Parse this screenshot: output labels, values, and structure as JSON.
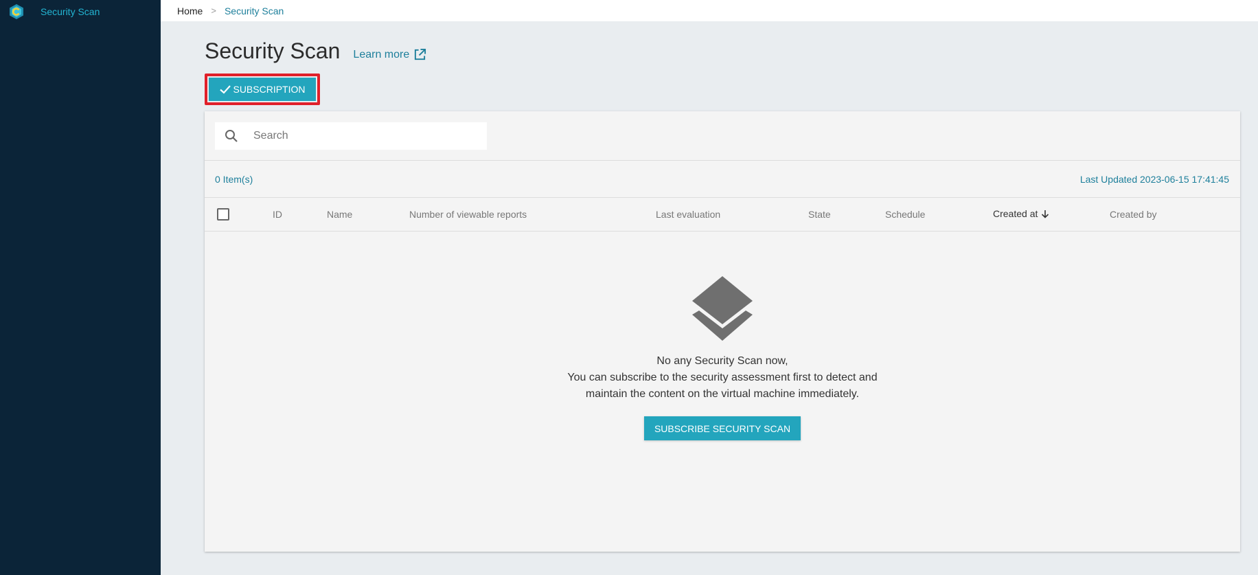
{
  "sidebar": {
    "brand_label": "Security Scan"
  },
  "breadcrumb": {
    "home": "Home",
    "separator": ">",
    "current": "Security Scan"
  },
  "page": {
    "title": "Security Scan",
    "learn_more": "Learn more",
    "subscription_button": "SUBSCRIPTION"
  },
  "search": {
    "placeholder": "Search",
    "value": ""
  },
  "list_meta": {
    "item_count": "0 Item(s)",
    "last_updated": "Last Updated 2023-06-15 17:41:45"
  },
  "table": {
    "columns": {
      "id": "ID",
      "name": "Name",
      "reports": "Number of viewable reports",
      "last_evaluation": "Last evaluation",
      "state": "State",
      "schedule": "Schedule",
      "created_at": "Created at",
      "created_by": "Created by"
    },
    "sort_column": "created_at",
    "sort_direction": "descending"
  },
  "empty_state": {
    "line1": "No any Security Scan now,",
    "line2": "You can subscribe to the security assessment first to detect and",
    "line3": "maintain the content on the virtual machine immediately.",
    "button": "SUBSCRIBE SECURITY SCAN"
  },
  "colors": {
    "sidebar_bg": "#0b2438",
    "accent": "#23a5bd",
    "link": "#1d7f9b",
    "highlight_border": "#e0202a"
  },
  "icons": {
    "logo": "app-logo-icon",
    "external_link": "external-link-icon",
    "check": "check-icon",
    "search": "search-icon",
    "sort": "arrow-down-icon",
    "empty": "layers-icon"
  }
}
